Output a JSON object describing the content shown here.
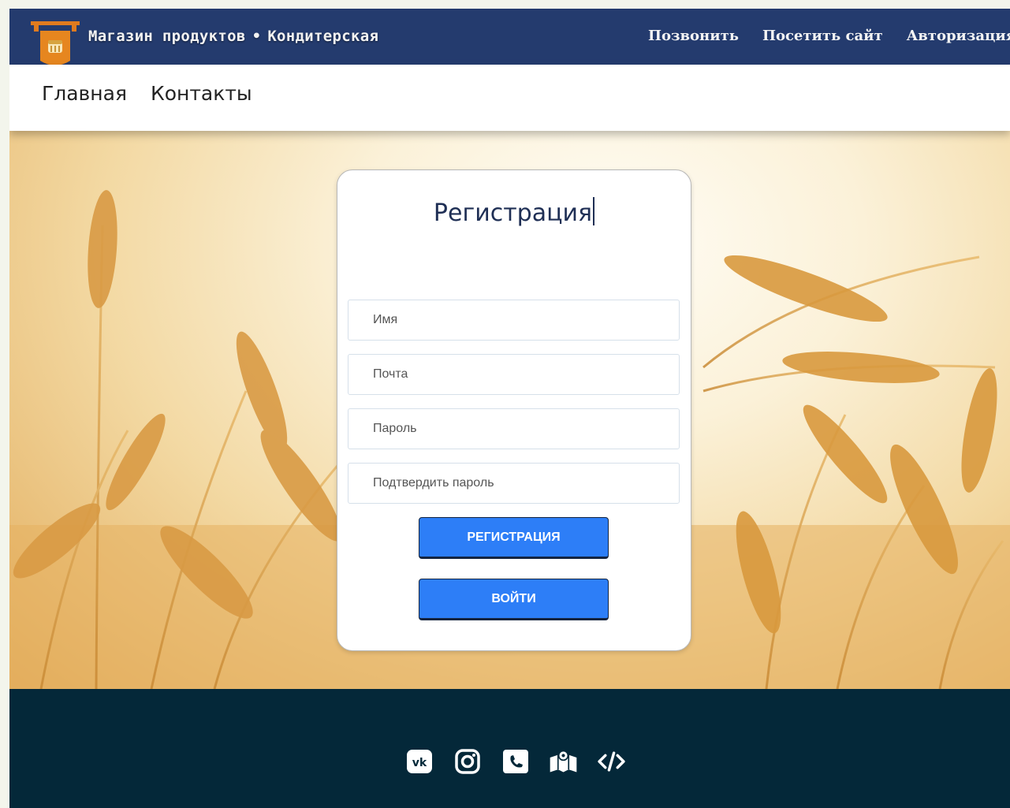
{
  "header": {
    "brand_left": "Магазин продуктов",
    "brand_separator": "•",
    "brand_right": "Кондитерская",
    "nav": [
      "Позвонить",
      "Посетить сайт",
      "Авторизация"
    ]
  },
  "subnav": {
    "links": [
      "Главная",
      "Контакты"
    ]
  },
  "form": {
    "title": "Регистрация",
    "fields": {
      "name_placeholder": "Имя",
      "email_placeholder": "Почта",
      "password_placeholder": "Пароль",
      "confirm_placeholder": "Подтвердить пароль"
    },
    "register_button": "РЕГИСТРАЦИЯ",
    "login_button": "ВОЙТИ"
  },
  "footer": {
    "social_icons": [
      "vk-icon",
      "instagram-icon",
      "phone-icon",
      "map-icon",
      "code-icon"
    ]
  },
  "colors": {
    "topbar": "#243b6e",
    "button": "#2d7ef7",
    "footer": "#042839"
  }
}
